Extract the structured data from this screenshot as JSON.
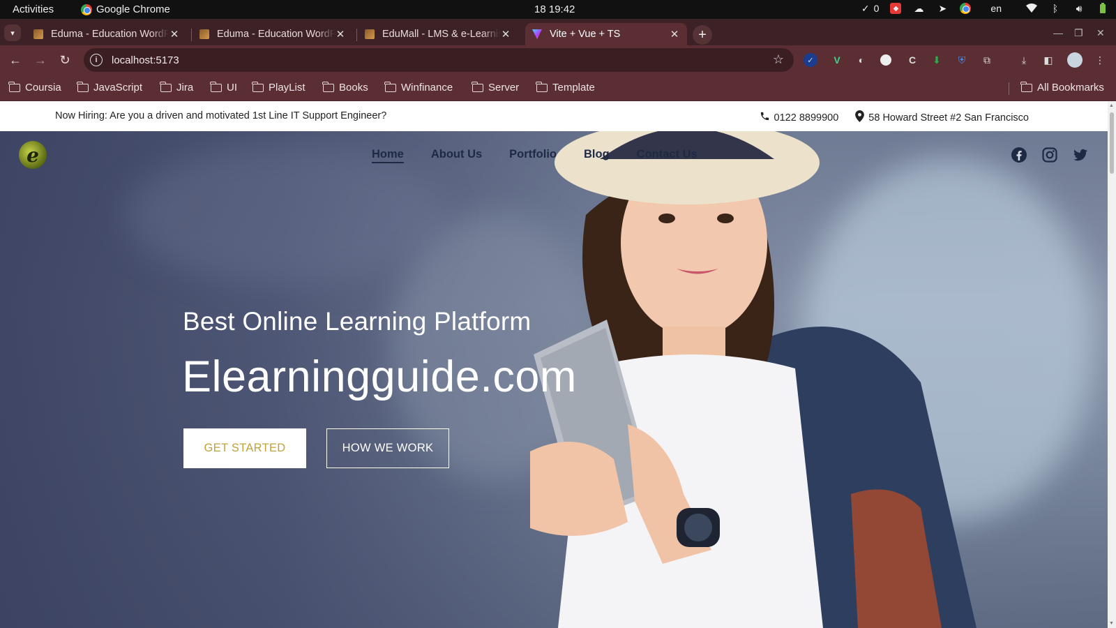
{
  "system_bar": {
    "activities": "Activities",
    "app_name": "Google Chrome",
    "clock": "18  19:42",
    "check_count": "0",
    "language": "en"
  },
  "tabs": [
    {
      "title": "Eduma - Education WordPress",
      "active": false
    },
    {
      "title": "Eduma - Education WordPress",
      "active": false
    },
    {
      "title": "EduMall - LMS & e-Learning",
      "active": false
    },
    {
      "title": "Vite + Vue + TS",
      "active": true
    }
  ],
  "toolbar": {
    "url": "localhost:5173"
  },
  "bookmarks": {
    "items": [
      "Coursia",
      "JavaScript",
      "Jira",
      "UI",
      "PlayList",
      "Books",
      "Winfinance",
      "Server",
      "Template"
    ],
    "all_label": "All Bookmarks"
  },
  "topinfo": {
    "hiring": "Now Hiring: Are you a driven and motivated 1st Line IT Support Engineer?",
    "phone": "0122 8899900",
    "address": "58 Howard Street #2 San Francisco"
  },
  "nav": {
    "items": [
      "Home",
      "About Us",
      "Portfolio",
      "Blog",
      "Contact Us"
    ],
    "active_index": 0
  },
  "social": [
    "facebook-icon",
    "instagram-icon",
    "twitter-icon"
  ],
  "hero": {
    "subtitle": "Best Online Learning Platform",
    "title": "Elearningguide.com",
    "primary_button": "GET STARTED",
    "secondary_button": "HOW WE WORK"
  },
  "colors": {
    "chrome_frame": "#5a2e33",
    "tab_strip": "#3c2226",
    "accent_gold": "#c0a23a",
    "nav_text": "#1e2a44"
  }
}
